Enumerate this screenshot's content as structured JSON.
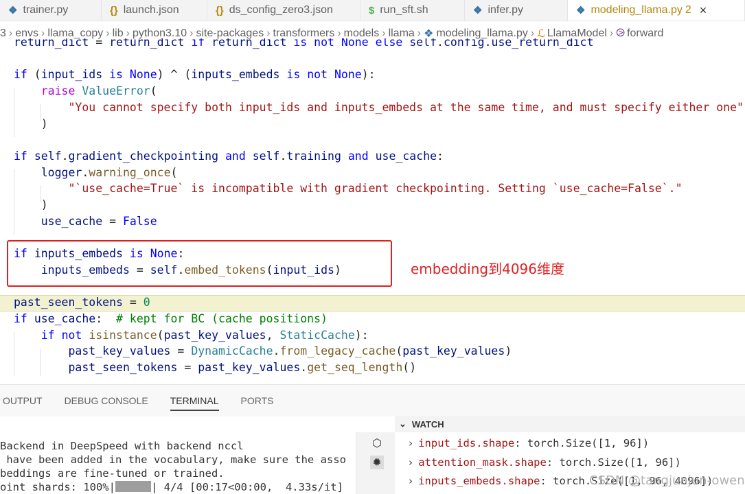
{
  "tabs": [
    {
      "icon": "python-icon",
      "glyph": "❖",
      "label": "trainer.py"
    },
    {
      "icon": "json-icon",
      "glyph": "{}",
      "label": "launch.json"
    },
    {
      "icon": "json-icon",
      "glyph": "{}",
      "label": "ds_config_zero3.json"
    },
    {
      "icon": "shell-icon",
      "glyph": "$",
      "label": "run_sft.sh"
    },
    {
      "icon": "python-icon",
      "glyph": "❖",
      "label": "infer.py"
    },
    {
      "icon": "python-icon",
      "glyph": "❖",
      "label": "modeling_llama.py",
      "modified": "2",
      "close": "×"
    }
  ],
  "breadcrumb": [
    "3",
    "envs",
    "llama_copy",
    "lib",
    "python3.10",
    "site-packages",
    "transformers",
    "models",
    "llama",
    "modeling_llama.py",
    "LlamaModel",
    "forward"
  ],
  "code_lines": [
    "return_dict = return_dict if return_dict is not None else self.config.use_return_dict",
    "",
    "if (input_ids is None) ^ (inputs_embeds is not None):",
    "    raise ValueError(",
    "        \"You cannot specify both input_ids and inputs_embeds at the same time, and must specify either one\"",
    "    )",
    "",
    "if self.gradient_checkpointing and self.training and use_cache:",
    "    logger.warning_once(",
    "        \"`use_cache=True` is incompatible with gradient checkpointing. Setting `use_cache=False`.\"",
    "    )",
    "    use_cache = False",
    "",
    "if inputs_embeds is None:",
    "    inputs_embeds = self.embed_tokens(input_ids)",
    "",
    "past_seen_tokens = 0",
    "if use_cache:  # kept for BC (cache positions)",
    "    if not isinstance(past_key_values, StaticCache):",
    "        past_key_values = DynamicCache.from_legacy_cache(past_key_values)",
    "        past_seen_tokens = past_key_values.get_seq_length()"
  ],
  "annotation": "embedding到4096维度",
  "panel_tabs": [
    "OUTPUT",
    "DEBUG CONSOLE",
    "TERMINAL",
    "PORTS"
  ],
  "active_panel": "TERMINAL",
  "terminal_lines": [
    "Backend in DeepSpeed with backend nccl",
    " have been added in the vocabulary, make sure the asso",
    "beddings are fine-tuned or trained.",
    "oint shards: 100%|"
  ],
  "terminal_progress_tail": "| 4/4 [00:17<00:00,  4.33s/it]",
  "watch": {
    "title": "WATCH",
    "items": [
      {
        "expr": "input_ids.shape",
        "value": "torch.Size([1, 96])"
      },
      {
        "expr": "attention_mask.shape",
        "value": "torch.Size([1, 96])"
      },
      {
        "expr": "inputs_embeds.shape",
        "value": "torch.Size([1, 96, 4096])"
      }
    ]
  },
  "watermark": "CSDN @tangjunjun-owen"
}
